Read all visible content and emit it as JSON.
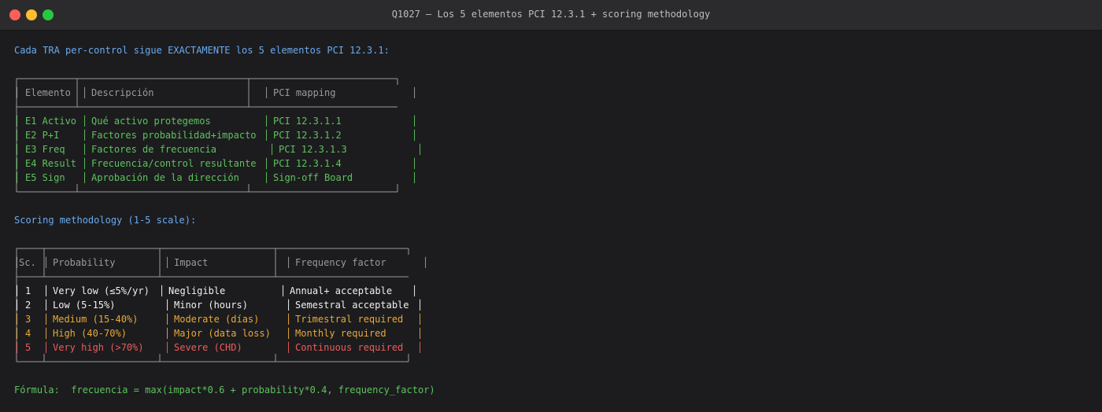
{
  "window": {
    "title": "Q1027 — Los 5 elementos PCI 12.3.1 + scoring methodology"
  },
  "intro": "Cada TRA per-control sigue EXACTAMENTE los 5 elementos PCI 12.3.1:",
  "elements_table": {
    "headers": [
      "Elemento",
      "Descripción",
      "PCI mapping"
    ],
    "rows": [
      [
        "E1 Activo",
        "Qué activo protegemos",
        "PCI 12.3.1.1"
      ],
      [
        "E2 P+I",
        "Factores probabilidad+impacto",
        "PCI 12.3.1.2"
      ],
      [
        "E3 Freq",
        "Factores de frecuencia",
        "PCI 12.3.1.3"
      ],
      [
        "E4 Result",
        "Frecuencia/control resultante",
        "PCI 12.3.1.4"
      ],
      [
        "E5 Sign",
        "Aprobación de la dirección",
        "Sign-off Board"
      ]
    ]
  },
  "scoring_heading": "Scoring methodology (1-5 scale):",
  "scoring_table": {
    "headers": [
      "Sc.",
      "Probability",
      "Impact",
      "Frequency factor"
    ],
    "rows": [
      [
        "1",
        "Very low (≤5%/yr)",
        "Negligible",
        "Annual+ acceptable"
      ],
      [
        "2",
        "Low (5-15%)",
        "Minor (hours)",
        "Semestral acceptable"
      ],
      [
        "3",
        "Medium (15-40%)",
        "Moderate (días)",
        "Trimestral required"
      ],
      [
        "4",
        "High (40-70%)",
        "Major (data loss)",
        "Monthly required"
      ],
      [
        "5",
        "Very high (>70%)",
        "Severe (CHD)",
        "Continuous required"
      ]
    ]
  },
  "formula": "Fórmula:  frecuencia = max(impact*0.6 + probability*0.4, frequency_factor)",
  "colors": {
    "heading": "#6aaaf0",
    "green_text": "#5ec25e",
    "border": "#9a9a9a",
    "low_score": "#f0f0f0",
    "medium_score": "#e8a838",
    "high_score": "#f05a5a"
  }
}
